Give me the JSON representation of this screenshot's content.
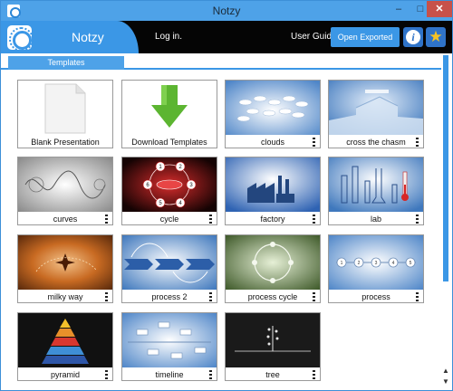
{
  "window": {
    "title": "Notzy"
  },
  "header": {
    "brand": "Notzy",
    "login": "Log in.",
    "user_guide": "User Guide",
    "open_exported": "Open Exported File",
    "info_icon": "info-icon",
    "star_icon": "star-icon"
  },
  "tabs": {
    "templates": "Templates"
  },
  "templates": [
    {
      "label": "Blank Presentation"
    },
    {
      "label": "Download Templates"
    },
    {
      "label": "clouds"
    },
    {
      "label": "cross the chasm"
    },
    {
      "label": "curves"
    },
    {
      "label": "cycle"
    },
    {
      "label": "factory"
    },
    {
      "label": "lab"
    },
    {
      "label": "milky way"
    },
    {
      "label": "process 2"
    },
    {
      "label": "process cycle"
    },
    {
      "label": "process"
    },
    {
      "label": "pyramid"
    },
    {
      "label": "timeline"
    },
    {
      "label": "tree"
    }
  ],
  "cycle_numbers": [
    "1",
    "2",
    "3",
    "4",
    "5",
    "6"
  ],
  "process_numbers": [
    "1",
    "2",
    "3",
    "4",
    "5"
  ],
  "colors": {
    "accent": "#3b97e6",
    "header_bg": "#050505",
    "title_bar": "#4ea2e8",
    "download_arrow": "#5cb531",
    "star": "#f6c324"
  }
}
